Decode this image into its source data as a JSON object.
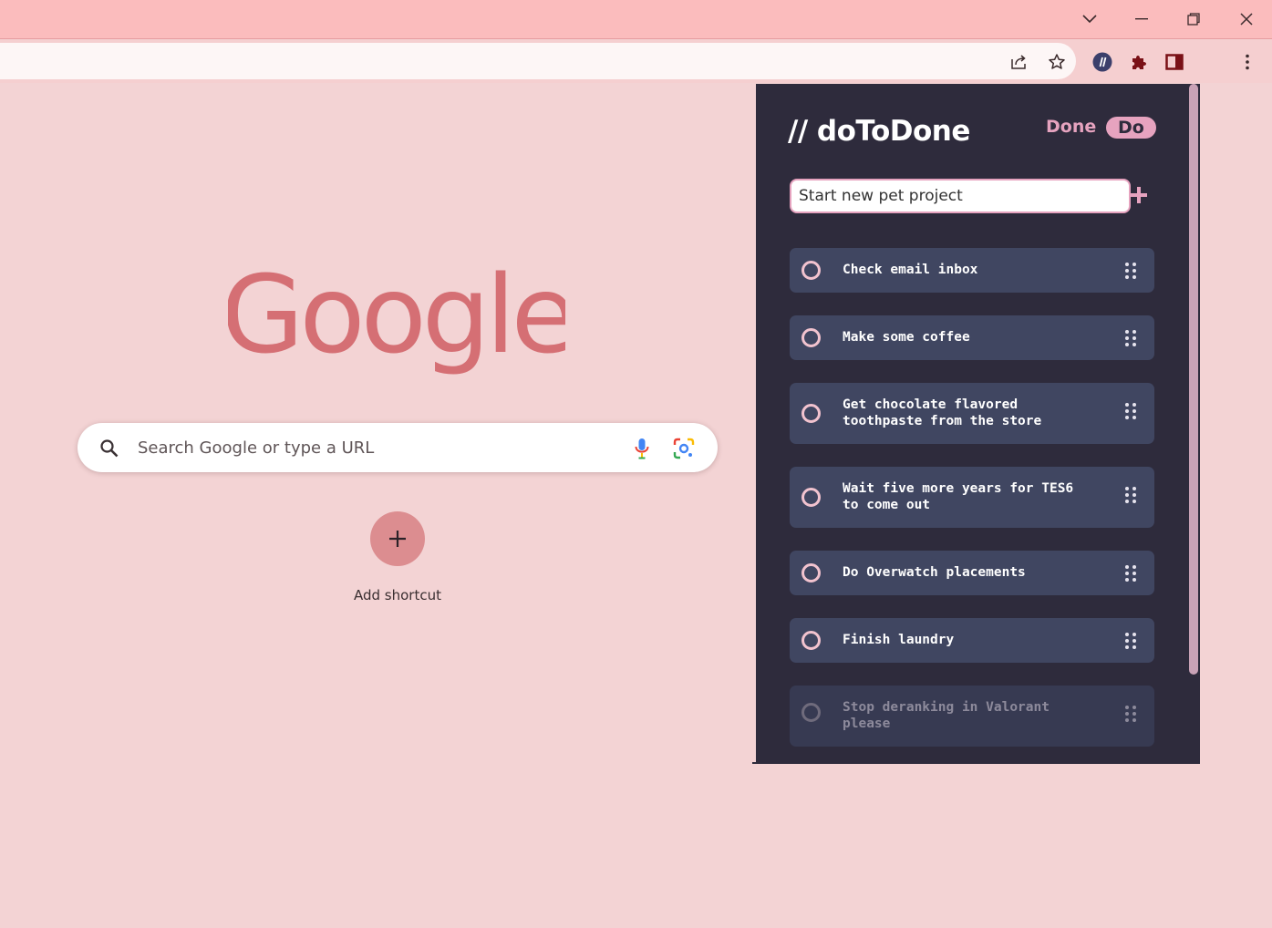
{
  "window": {
    "controls": [
      "tab-search",
      "minimize",
      "restore",
      "close"
    ]
  },
  "toolbar": {
    "icons": [
      "share-icon",
      "star-icon",
      "dotodone-extension-icon",
      "puzzle-icon",
      "side-panel-icon",
      "menu-icon"
    ]
  },
  "ntp": {
    "logo_text": "Google",
    "search_placeholder": "Search Google or type a URL",
    "shortcut_label": "Add shortcut"
  },
  "extension": {
    "brand": "// doToDone",
    "tab_done": "Done",
    "tab_do": "Do",
    "input_value": "Start new pet project",
    "tasks": [
      {
        "text": "Check email inbox",
        "faded": false
      },
      {
        "text": "Make some coffee",
        "faded": false
      },
      {
        "text": "Get chocolate flavored toothpaste from the store",
        "faded": false
      },
      {
        "text": "Wait five more years for TES6 to come out",
        "faded": false
      },
      {
        "text": "Do Overwatch placements",
        "faded": false
      },
      {
        "text": "Finish laundry",
        "faded": false
      },
      {
        "text": "Stop deranking in Valorant please",
        "faded": true
      }
    ]
  },
  "colors": {
    "accent": "#e6a3bf",
    "panel": "#2e2b3c",
    "task": "#404661",
    "page": "#f3d3d4"
  }
}
